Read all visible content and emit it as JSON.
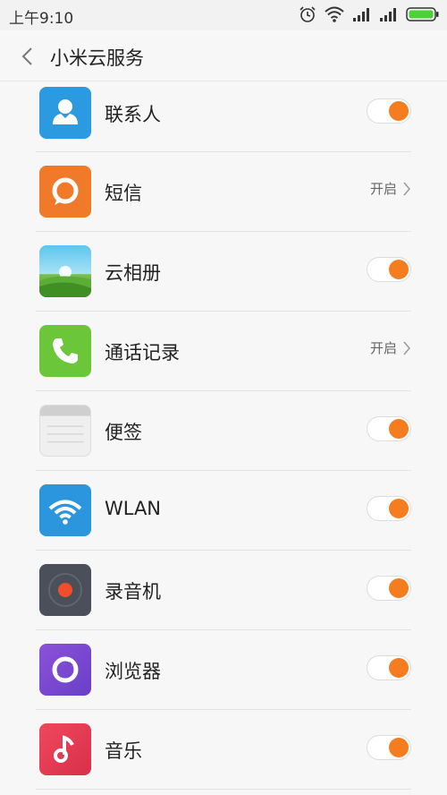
{
  "status_bar": {
    "time": "上午9:10",
    "icons": [
      "alarm-icon",
      "wifi-icon",
      "signal-icon",
      "signal-icon",
      "battery-icon"
    ],
    "battery_color": "#4cd137"
  },
  "header": {
    "title": "小米云服务",
    "back_icon": "chevron-left-icon"
  },
  "accent_color": "#f57c1f",
  "items": [
    {
      "label": "联系人",
      "icon": "contacts-icon",
      "control": "toggle",
      "on": true
    },
    {
      "label": "短信",
      "icon": "sms-icon",
      "control": "link",
      "status": "开启"
    },
    {
      "label": "云相册",
      "icon": "gallery-icon",
      "control": "toggle",
      "on": true
    },
    {
      "label": "通话记录",
      "icon": "phone-icon",
      "control": "link",
      "status": "开启"
    },
    {
      "label": "便签",
      "icon": "notes-icon",
      "control": "toggle",
      "on": true
    },
    {
      "label": "WLAN",
      "icon": "wifi-icon",
      "control": "toggle",
      "on": true
    },
    {
      "label": "录音机",
      "icon": "recorder-icon",
      "control": "toggle",
      "on": true
    },
    {
      "label": "浏览器",
      "icon": "browser-icon",
      "control": "toggle",
      "on": true
    },
    {
      "label": "音乐",
      "icon": "music-icon",
      "control": "toggle",
      "on": true
    }
  ]
}
